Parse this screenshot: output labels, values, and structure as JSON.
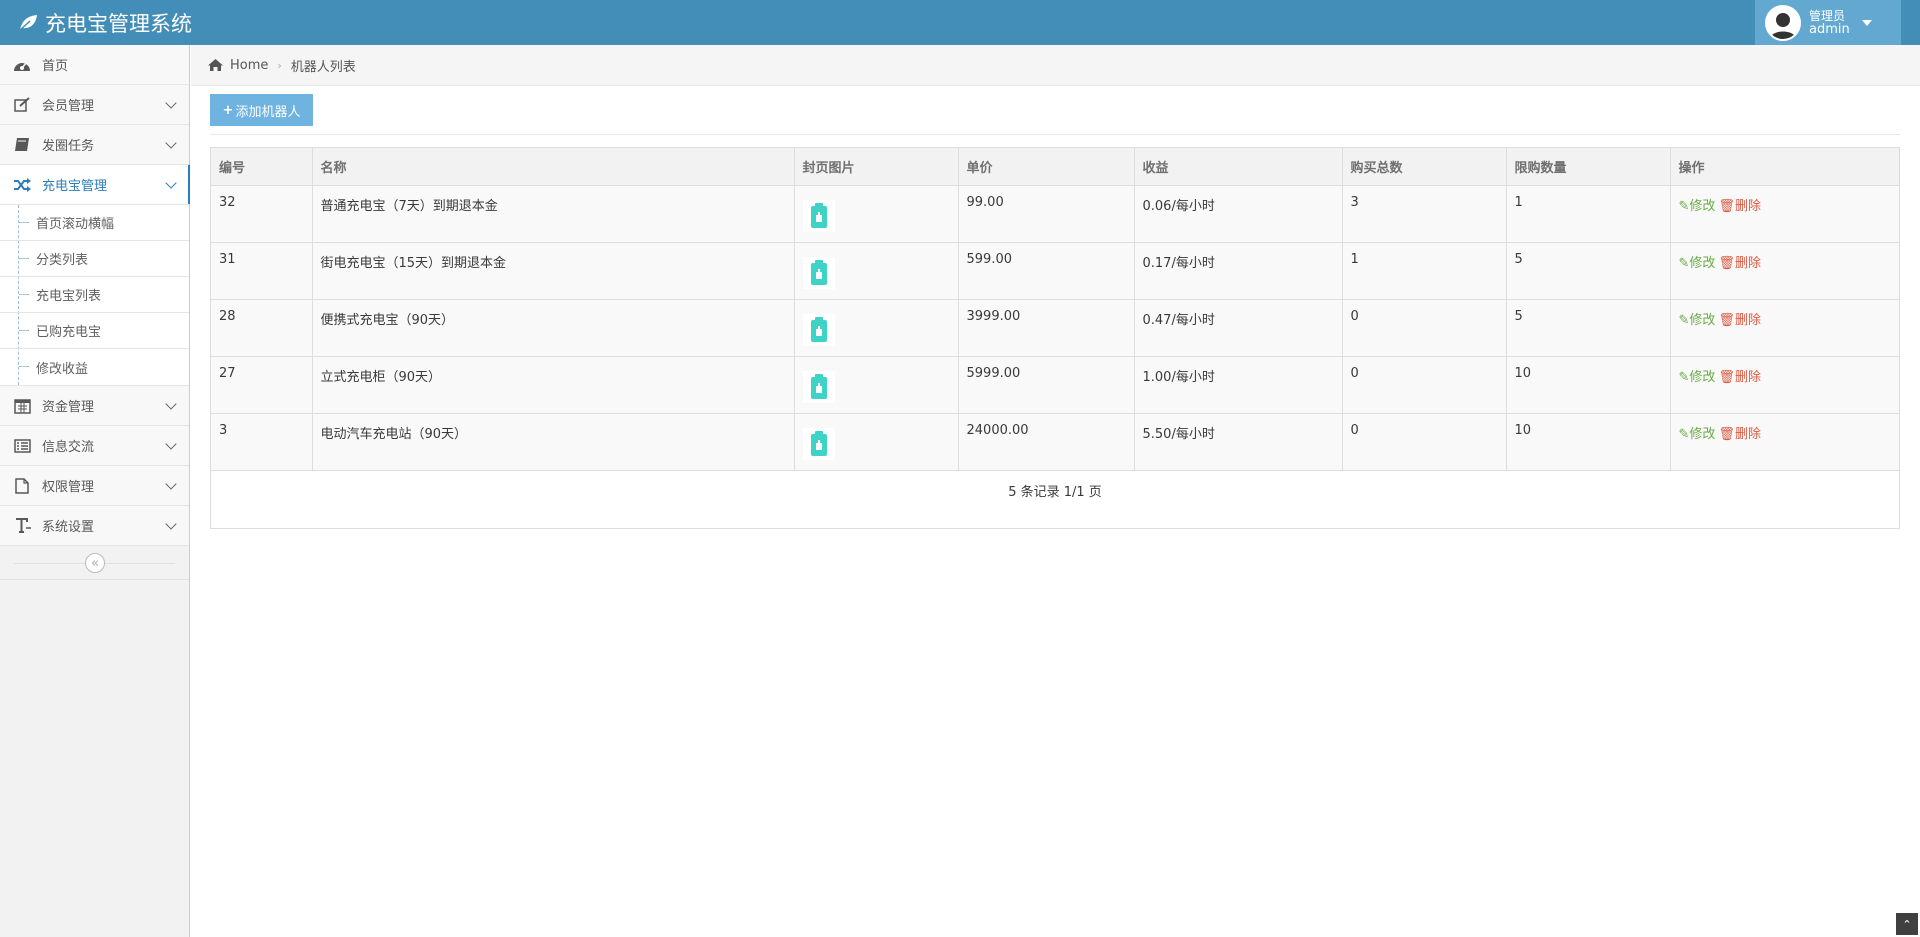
{
  "app": {
    "title": "充电宝管理系统"
  },
  "user": {
    "role": "管理员",
    "name": "admin"
  },
  "sidebar": {
    "items": [
      {
        "label": "首页"
      },
      {
        "label": "会员管理"
      },
      {
        "label": "发圈任务"
      },
      {
        "label": "充电宝管理"
      },
      {
        "label": "资金管理"
      },
      {
        "label": "信息交流"
      },
      {
        "label": "权限管理"
      },
      {
        "label": "系统设置"
      }
    ],
    "submenu": [
      {
        "label": "首页滚动横幅"
      },
      {
        "label": "分类列表"
      },
      {
        "label": "充电宝列表"
      },
      {
        "label": "已购充电宝"
      },
      {
        "label": "修改收益"
      }
    ]
  },
  "breadcrumb": {
    "home": "Home",
    "current": "机器人列表"
  },
  "toolbar": {
    "add_label": "添加机器人"
  },
  "table": {
    "headers": [
      "编号",
      "名称",
      "封页图片",
      "单价",
      "收益",
      "购买总数",
      "限购数量",
      "操作"
    ],
    "rows": [
      {
        "id": "32",
        "name": "普通充电宝（7天）到期退本金",
        "price": "99.00",
        "income": "0.06/每小时",
        "total": "3",
        "limit": "1"
      },
      {
        "id": "31",
        "name": "街电充电宝（15天）到期退本金",
        "price": "599.00",
        "income": "0.17/每小时",
        "total": "1",
        "limit": "5"
      },
      {
        "id": "28",
        "name": "便携式充电宝（90天）",
        "price": "3999.00",
        "income": "0.47/每小时",
        "total": "0",
        "limit": "5"
      },
      {
        "id": "27",
        "name": "立式充电柜（90天）",
        "price": "5999.00",
        "income": "1.00/每小时",
        "total": "0",
        "limit": "10"
      },
      {
        "id": "3",
        "name": "电动汽车充电站（90天）",
        "price": "24000.00",
        "income": "5.50/每小时",
        "total": "0",
        "limit": "10"
      }
    ],
    "actions": {
      "edit": "修改",
      "delete": "删除"
    },
    "pager": "5 条记录 1/1 页"
  },
  "colors": {
    "navbar": "#438eb9",
    "accent": "#2b7dbc",
    "edit": "#69aa46",
    "delete": "#dd5a43",
    "thumb": "#3fd2c6"
  }
}
